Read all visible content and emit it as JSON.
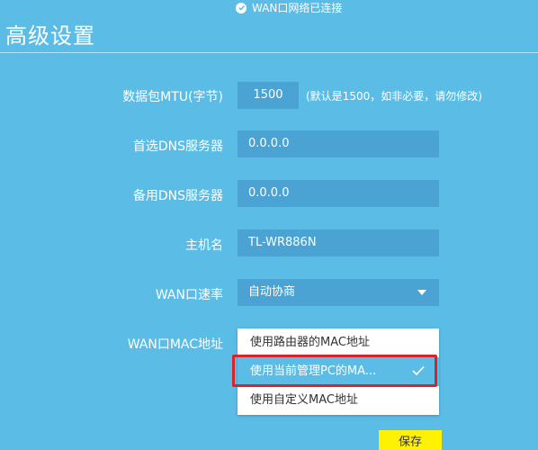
{
  "status": {
    "icon": "check-circle-icon",
    "text": "WAN口网络已连接"
  },
  "page_title": "高级设置",
  "form": {
    "mtu": {
      "label": "数据包MTU(字节)",
      "value": "1500",
      "hint": "(默认是1500，如非必要，请勿修改)"
    },
    "primary_dns": {
      "label": "首选DNS服务器",
      "value": "0.0.0.0"
    },
    "secondary_dns": {
      "label": "备用DNS服务器",
      "value": "0.0.0.0"
    },
    "hostname": {
      "label": "主机名",
      "value": "TL-WR886N"
    },
    "wan_speed": {
      "label": "WAN口速率",
      "value": "自动协商"
    },
    "wan_mac": {
      "label": "WAN口MAC地址",
      "options": [
        "使用路由器的MAC地址",
        "使用当前管理PC的MA...",
        "使用自定义MAC地址"
      ],
      "selected_index": 1
    }
  },
  "save_label": "保存",
  "colors": {
    "background": "#5bbde6",
    "field_background": "#4aa3d2",
    "highlight": "#d8232a",
    "save_button": "#fff200"
  }
}
